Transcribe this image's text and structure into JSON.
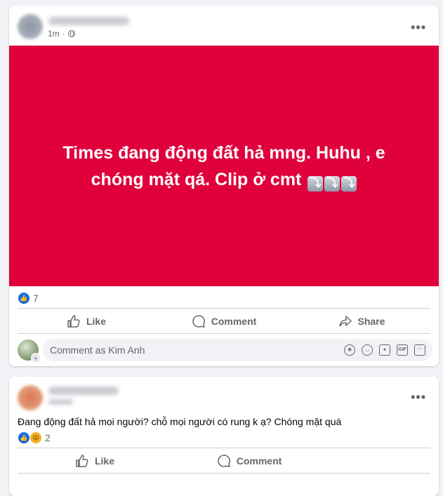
{
  "post1": {
    "time": "1m",
    "more": "•••",
    "banner_text": "Times đang động đất hả mng. Huhu , e chóng mặt qá. Clip ở cmt",
    "banner_emojis": [
      "⤵",
      "⤵",
      "⤵"
    ],
    "reaction_count": "7",
    "actions": {
      "like": "Like",
      "comment": "Comment",
      "share": "Share"
    },
    "comment_placeholder": "Comment as Kim Anh",
    "comment_icons": [
      "avatar-sticker-icon",
      "emoji-icon",
      "camera-icon",
      "gif-icon",
      "sticker-icon"
    ]
  },
  "post2": {
    "more": "•••",
    "text": "Đang động đất hả moi người? chỗ mọi người có rung k ạ? Chóng mặt quá",
    "reaction_count": "2",
    "actions": {
      "like": "Like",
      "comment": "Comment"
    }
  },
  "colors": {
    "banner": "#e0003c",
    "accent": "#1877f2"
  }
}
